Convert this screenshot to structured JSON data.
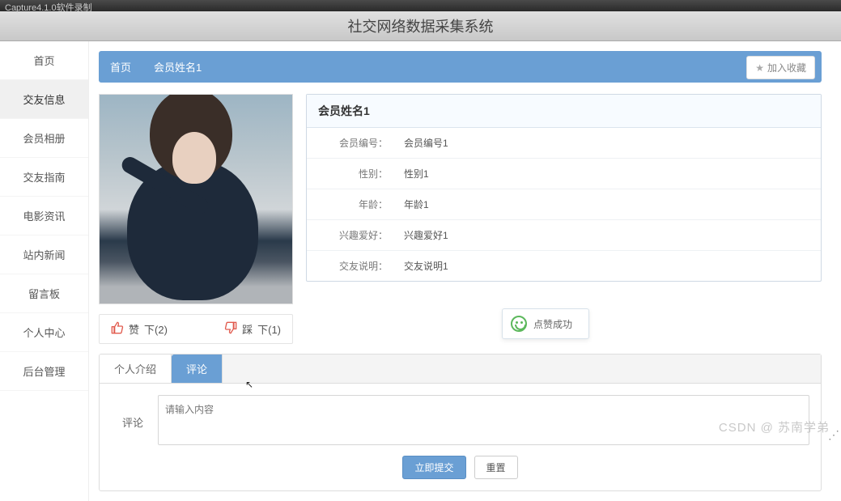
{
  "window": {
    "title": "Capture4.1.0软件录制"
  },
  "header": {
    "title": "社交网络数据采集系统"
  },
  "sidebar": {
    "items": [
      {
        "label": "首页"
      },
      {
        "label": "交友信息"
      },
      {
        "label": "会员相册"
      },
      {
        "label": "交友指南"
      },
      {
        "label": "电影资讯"
      },
      {
        "label": "站内新闻"
      },
      {
        "label": "留言板"
      },
      {
        "label": "个人中心"
      },
      {
        "label": "后台管理"
      }
    ],
    "active_index": 1
  },
  "breadcrumb": {
    "home": "首页",
    "current": "会员姓名1",
    "favorite_label": "加入收藏"
  },
  "member": {
    "name_title": "会员姓名1",
    "fields": [
      {
        "label": "会员编号",
        "value": "会员编号1"
      },
      {
        "label": "性别",
        "value": "性别1"
      },
      {
        "label": "年龄",
        "value": "年龄1"
      },
      {
        "label": "兴趣爱好",
        "value": "兴趣爱好1"
      },
      {
        "label": "交友说明",
        "value": "交友说明1"
      }
    ]
  },
  "actions": {
    "like_label": "赞",
    "like_count": "下(2)",
    "dislike_label": "踩",
    "dislike_count": "下(1)"
  },
  "toast": {
    "message": "点赞成功"
  },
  "tabs": {
    "items": [
      {
        "label": "个人介绍"
      },
      {
        "label": "评论"
      }
    ],
    "active_index": 1
  },
  "comment_form": {
    "label": "评论",
    "placeholder": "请输入内容",
    "submit": "立即提交",
    "reset": "重置"
  },
  "watermark": "CSDN @ 苏南学弟"
}
